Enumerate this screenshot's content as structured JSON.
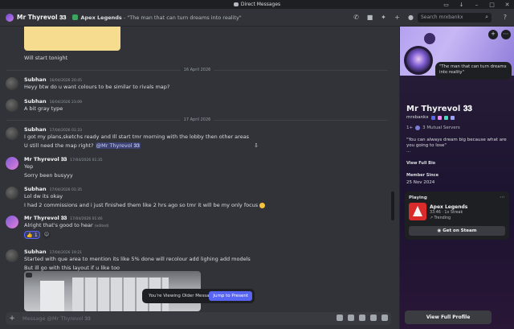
{
  "window": {
    "title": "Direct Messages"
  },
  "header": {
    "username": "Mr Thyrevol",
    "tag": "𝟑𝟑",
    "activity_game": "Apex Legends",
    "activity_status": "- \"The man that can turn dreams into reality\"",
    "search_placeholder": "Search mrxbankx"
  },
  "messages": {
    "top_text": "Will start tonight",
    "divider1": "16 April 2026",
    "m1": {
      "author": "Subhan",
      "time": "16/04/2026 20:45",
      "text": "Heyy btw do u want colours to be similar to rivals map?"
    },
    "m2": {
      "author": "Subhan",
      "time": "16/04/2026 23:09",
      "text": "A bit gray type"
    },
    "divider2": "17 April 2026",
    "m3": {
      "author": "Subhan",
      "time": "17/04/2026 01:33",
      "line1": "I got my plans,sketchs ready and Ill start tmr morning with the lobby then other areas",
      "line2": "U still need the map right?",
      "mention": "@Mr Thyrevol 𝟑𝟑"
    },
    "m4": {
      "author": "Mr Thyrevol 𝟑𝟑",
      "time": "17/04/2026 01:35",
      "line1": "Yep",
      "line2": "Sorry been busyyy"
    },
    "m5": {
      "author": "Subhan",
      "time": "17/04/2026 01:35",
      "line1": "Lol dw its okay",
      "line2": "I had 2 commissions and i just finished them like 2 hrs ago so tmr it will be my only focus"
    },
    "m6": {
      "author": "Mr Thyrevol 𝟑𝟑",
      "time": "17/04/2026 01:46",
      "text": "Alright that's good to hear",
      "edited": "(edited)",
      "reaction_count": "1"
    },
    "m7": {
      "author": "Subhan",
      "time": "17/04/2026 19:21",
      "line1": "Started with que area to mention its like 5% done will recolour add lighing add models",
      "line2": "But ill go with this layout if u like too"
    },
    "older_label": "You're Viewing Older Messages",
    "jump_label": "Jump to Present",
    "composer_placeholder": "Message @Mr Thyrevol 𝟑𝟑"
  },
  "profile": {
    "quote": "\"The man that can turn dreams into reality\"",
    "display_name": "Mr Thyrevol 𝟑𝟑",
    "handle": "mrxbankx",
    "mutual": "3 Mutual Servers",
    "mutual_prefix": "1+",
    "bio": "\"You can always dream big because what are you going to lose\"",
    "bio_more": "...",
    "view_bio": "View Full Bio",
    "member_since_label": "Member Since",
    "member_since": "25 Nov 2024",
    "playing_label": "Playing",
    "game": "Apex Legends",
    "game_meta": "33:46 · 1x Streak",
    "trending": "Trending",
    "steam_button": "Get on Steam",
    "view_full": "View Full Profile"
  },
  "colors": {
    "accent": "#5865f2",
    "online": "#3ba55d",
    "banner": "#b3a1f0"
  }
}
